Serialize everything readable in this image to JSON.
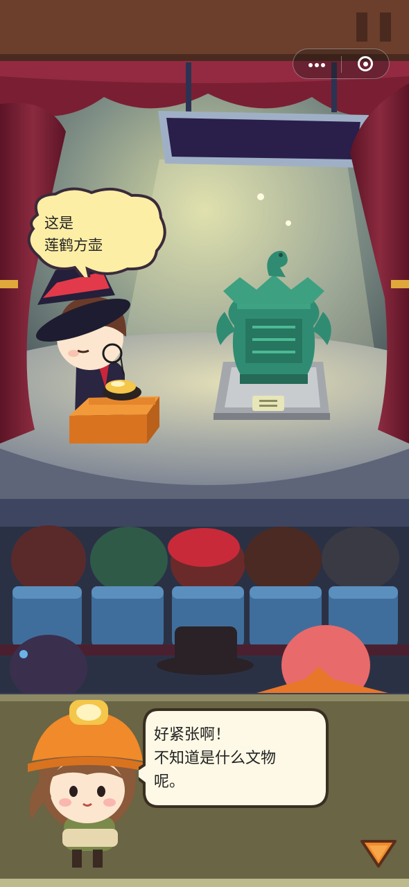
{
  "host_bubble": {
    "line1": "这是",
    "line2": "莲鹤方壶"
  },
  "dialog": {
    "line1": "好紧张啊！",
    "line2": "不知道是什么文物",
    "line3": "呢。"
  },
  "capsule": {
    "more_icon": "more-dots-icon",
    "close_icon": "target-close-icon"
  },
  "colors": {
    "curtain": "#7a1f33",
    "stage_floor": "#9aa0a8",
    "artifact": "#2f8c72",
    "bubble_fill": "#fdeea6",
    "dialog_bg": "#6a6544",
    "next_arrow": "#f08a2a"
  }
}
